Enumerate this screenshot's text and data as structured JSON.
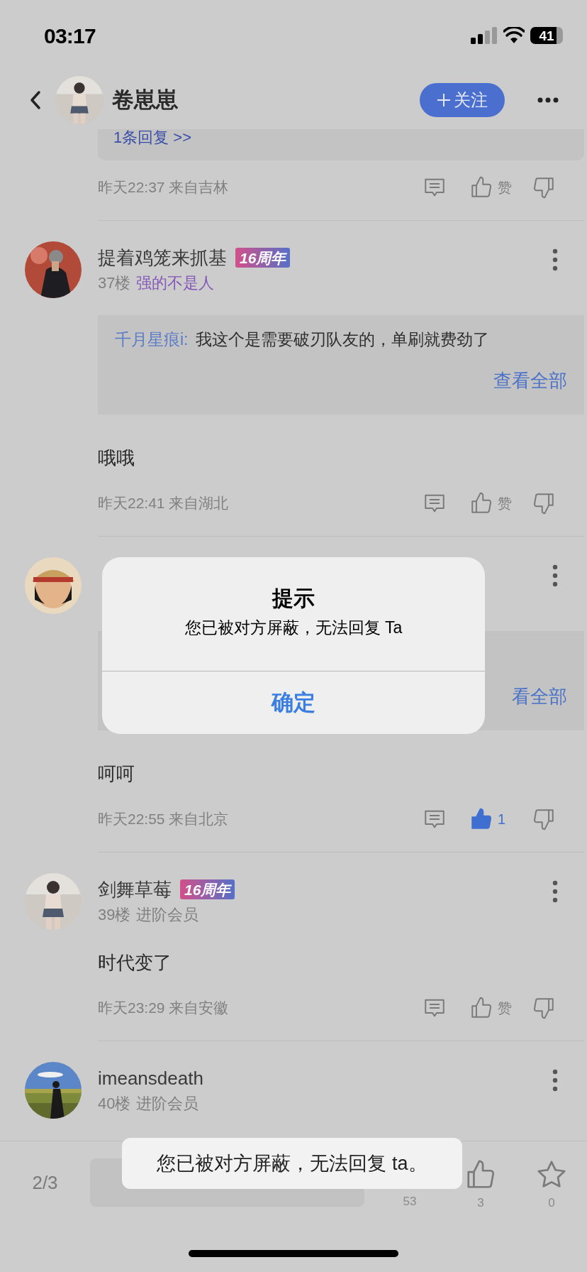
{
  "status_bar": {
    "time": "03:17",
    "battery": "41"
  },
  "header": {
    "title": "卷崽崽",
    "follow_button": "关注"
  },
  "thread": [
    {
      "kind": "tail",
      "reply_link": "1条回复 >>",
      "time_place": "昨天22:37 来自吉林",
      "like_text": "赞",
      "liked": false
    },
    {
      "kind": "comment",
      "name": "提着鸡笼来抓基",
      "badge": "16周年",
      "floor": "37楼",
      "title": "强的不是人",
      "color": "#8457b8",
      "reply": {
        "author": "千月星痕i:",
        "text": "我这个是需要破刃队友的，单刷就费劲了",
        "more": "查看全部"
      },
      "content": "哦哦",
      "time_place": "昨天22:41 来自湖北",
      "like_text": "赞",
      "liked": false
    },
    {
      "kind": "covered",
      "reply": {
        "more": "看全部"
      },
      "content": "呵呵",
      "time_place": "昨天22:55 来自北京",
      "like_text": "1",
      "liked": true
    },
    {
      "kind": "comment",
      "name": "剑舞草莓",
      "badge": "16周年",
      "floor": "39楼",
      "title": "进阶会员",
      "color": "#808080",
      "content": "时代变了",
      "time_place": "昨天23:29 来自安徽",
      "like_text": "赞",
      "liked": false
    },
    {
      "kind": "comment",
      "name": "imeansdeath",
      "floor": "40楼",
      "title": "进阶会员",
      "color": "#808080"
    }
  ],
  "bottom_bar": {
    "page": "2/3",
    "counts": [
      "53",
      "3",
      "0"
    ]
  },
  "alert": {
    "title": "提示",
    "message": "您已被对方屏蔽，无法回复 Ta",
    "button": "确定"
  },
  "toast": {
    "text": "您已被对方屏蔽，无法回复 ta。"
  }
}
